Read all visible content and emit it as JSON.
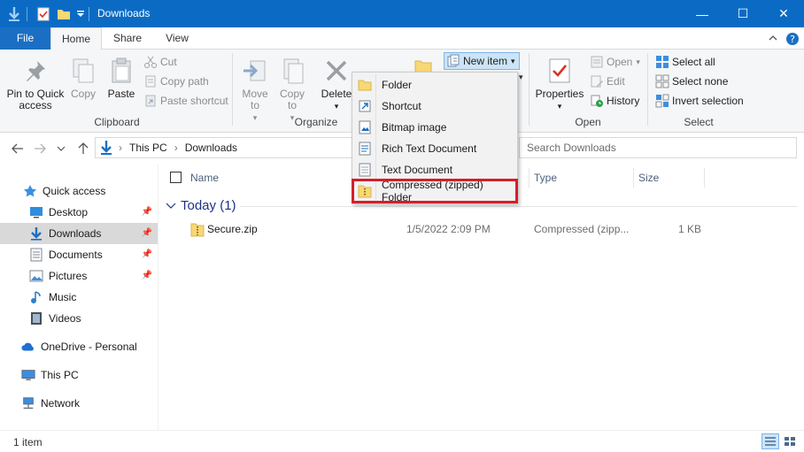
{
  "window": {
    "title": "Downloads",
    "controls": {
      "minimize": "—",
      "maximize": "☐",
      "close": "✕"
    }
  },
  "ribbon": {
    "tabs": [
      "File",
      "Home",
      "Share",
      "View"
    ],
    "clipboard": {
      "label": "Clipboard",
      "pin": "Pin to Quick access",
      "copy": "Copy",
      "paste": "Paste",
      "cut": "Cut",
      "copy_path": "Copy path",
      "paste_shortcut": "Paste shortcut"
    },
    "organize": {
      "label": "Organize",
      "move_to": "Move to",
      "copy_to": "Copy to",
      "delete": "Delete"
    },
    "new": {
      "new_item": "New item"
    },
    "open": {
      "label": "Open",
      "properties": "Properties",
      "open": "Open",
      "edit": "Edit",
      "history": "History"
    },
    "select": {
      "label": "Select",
      "select_all": "Select all",
      "select_none": "Select none",
      "invert": "Invert selection"
    }
  },
  "new_item_menu": [
    {
      "label": "Folder",
      "icon": "folder-icon"
    },
    {
      "label": "Shortcut",
      "icon": "shortcut-icon"
    },
    {
      "label": "Bitmap image",
      "icon": "bitmap-icon"
    },
    {
      "label": "Rich Text Document",
      "icon": "rtf-icon"
    },
    {
      "label": "Text Document",
      "icon": "text-document-icon"
    },
    {
      "label": "Compressed (zipped) Folder",
      "icon": "zip-folder-icon",
      "highlighted": true
    }
  ],
  "address": {
    "segments": [
      "This PC",
      "Downloads"
    ],
    "search_placeholder": "Search Downloads"
  },
  "nav_pane": [
    {
      "label": "Quick access",
      "icon": "star-icon"
    },
    {
      "label": "Desktop",
      "icon": "desktop-icon",
      "pinned": true
    },
    {
      "label": "Downloads",
      "icon": "downloads-icon",
      "pinned": true,
      "selected": true
    },
    {
      "label": "Documents",
      "icon": "documents-icon",
      "pinned": true
    },
    {
      "label": "Pictures",
      "icon": "pictures-icon",
      "pinned": true
    },
    {
      "label": "Music",
      "icon": "music-icon"
    },
    {
      "label": "Videos",
      "icon": "videos-icon"
    },
    {
      "label": "OneDrive - Personal",
      "icon": "cloud-icon"
    },
    {
      "label": "This PC",
      "icon": "pc-icon"
    },
    {
      "label": "Network",
      "icon": "network-icon"
    }
  ],
  "columns": {
    "name": "Name",
    "type": "Type",
    "size": "Size"
  },
  "group": {
    "label": "Today (1)"
  },
  "files": [
    {
      "name": "Secure.zip",
      "date": "1/5/2022 2:09 PM",
      "type": "Compressed (zipp...",
      "size": "1 KB"
    }
  ],
  "status": {
    "item_count": "1 item"
  },
  "colors": {
    "titlebar": "#0b6bc4",
    "selection": "#cce4f7",
    "highlight_box": "#d41e2a"
  }
}
